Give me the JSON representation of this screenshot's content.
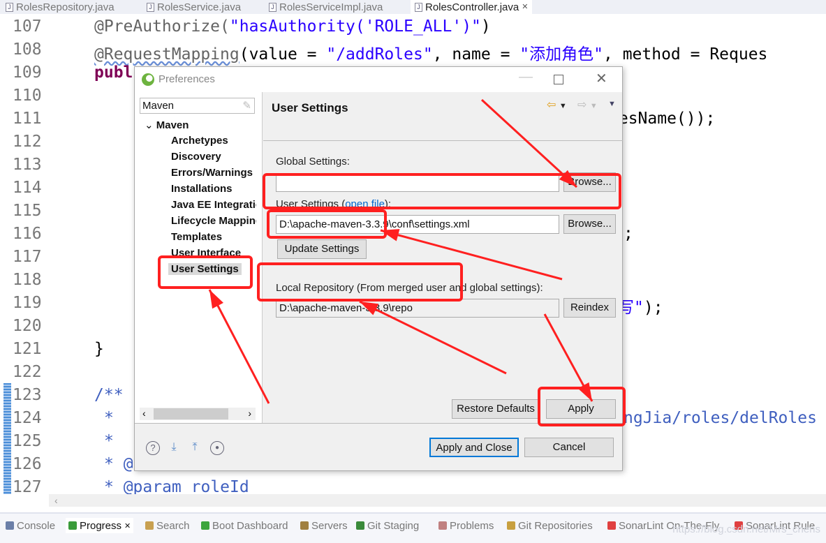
{
  "editor_tabs": [
    {
      "label": "RolesRepository.java",
      "active": false
    },
    {
      "label": "RolesService.java",
      "active": false
    },
    {
      "label": "RolesServiceImpl.java",
      "active": false
    },
    {
      "label": "RolesController.java",
      "active": true,
      "close": "✕"
    }
  ],
  "code": {
    "line_numbers": [
      "107",
      "108",
      "109",
      "110",
      "111",
      "112",
      "113",
      "114",
      "115",
      "116",
      "117",
      "118",
      "119",
      "120",
      "121",
      "122",
      "123",
      "124",
      "125",
      "126",
      "127"
    ],
    "l107": {
      "ann": "@PreAuthorize(",
      "str": "\"hasAuthority('ROLE_ALL')\"",
      "end": ")"
    },
    "l108": {
      "ann": "@RequestMapping",
      "a": "(value = ",
      "s1": "\"/addRoles\"",
      "b": ", name = ",
      "s2": "\"添加角色\"",
      "c": ", method = Reques"
    },
    "l109": "publ",
    "l111": "lesName());",
    "l116": ";",
    "l119s": "填写\"",
    "l119": ");",
    "l121": "}",
    "l123": "/**",
    "l124": "* ",
    "l124r": "ngJia/roles/delRoles",
    "l125": "*",
    "l126": "* @",
    "l127": "* @param roleId"
  },
  "dialog": {
    "title": "Preferences",
    "filter_value": "Maven",
    "tree": {
      "root": "Maven",
      "children": [
        "Archetypes",
        "Discovery",
        "Errors/Warnings",
        "Installations",
        "Java EE Integration",
        "Lifecycle Mappings",
        "Templates",
        "User Interface",
        "User Settings"
      ],
      "selected": "User Settings"
    },
    "page_title": "User Settings",
    "global_label": "Global Settings:",
    "global_value": "",
    "browse": "Browse...",
    "user_label": "User Settings (",
    "open_file": "open file",
    "user_label_end": "):",
    "user_value": "D:\\apache-maven-3.3.9\\conf\\settings.xml",
    "update": "Update Settings",
    "local_label": "Local Repository (From merged user and global settings):",
    "local_value": "D:\\apache-maven-3.3.9\\repo",
    "reindex": "Reindex",
    "restore": "Restore Defaults",
    "apply": "Apply",
    "apply_close": "Apply and Close",
    "cancel": "Cancel"
  },
  "bottom_tabs": [
    "Console",
    "Progress",
    "Search",
    "Boot Dashboard",
    "Servers",
    "Git Staging",
    "Problems",
    "Git Repositories",
    "SonarLint On-The-Fly",
    "SonarLint Rule"
  ],
  "watermark": "https://blog.csdn.net/Mrs_chens",
  "colors": {
    "annotation": "#ff2020"
  }
}
